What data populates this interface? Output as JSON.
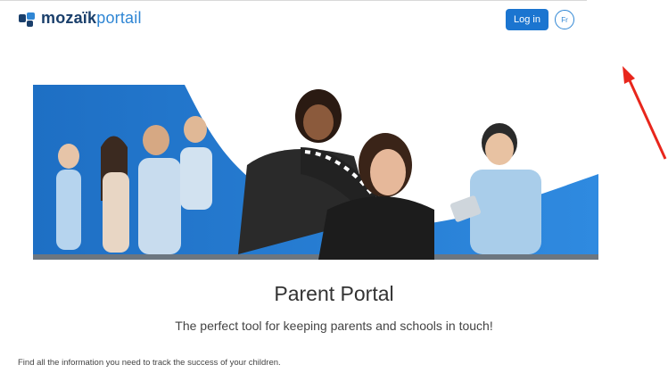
{
  "header": {
    "logo_bold": "mozaïk",
    "logo_light": "portail",
    "login_label": "Log in",
    "lang_label": "Fr"
  },
  "hero": {
    "title": "Parent Portal",
    "subtitle": "The perfect tool for keeping parents and schools in touch!"
  },
  "body_text": "Find all the information you need to track the success of your children.",
  "colors": {
    "brand_dark": "#1a3f6b",
    "brand_blue": "#2f86d4",
    "button_blue": "#1b75d0",
    "annotation_arrow": "#e8261c"
  }
}
